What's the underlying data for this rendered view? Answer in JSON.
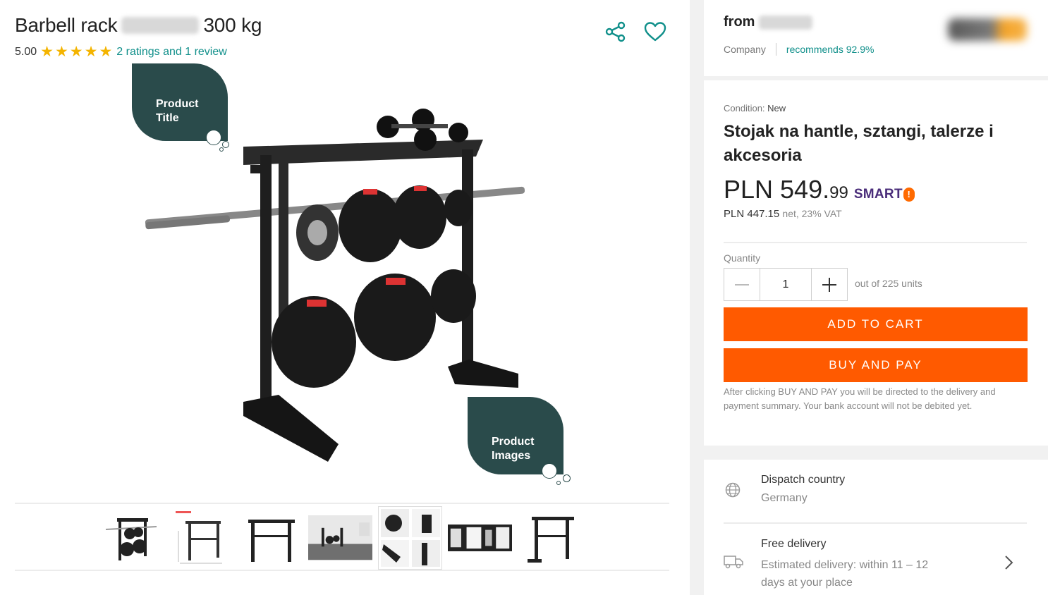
{
  "product": {
    "title_start": "Barbell rack",
    "title_end": "300 kg",
    "rating_score": "5.00",
    "rating_count": 5,
    "ratings_link": "2 ratings and 1 review"
  },
  "annotations": {
    "title_bubble": [
      "Product",
      "Title"
    ],
    "images_bubble": [
      "Product",
      "Images"
    ]
  },
  "icons": {
    "share": "share-icon",
    "favorite": "heart-icon",
    "dispatch": "globe-icon",
    "delivery": "truck-icon",
    "more": "chevron-right-icon"
  },
  "gallery": {
    "thumb_count": 7
  },
  "seller": {
    "from_label": "from",
    "type": "Company",
    "recommends": "recommends 92.9%"
  },
  "offer": {
    "condition_label": "Condition:",
    "condition_value": "New",
    "title": "Stojak na hantle, sztangi, talerze i akcesoria",
    "price_main": "PLN 549.",
    "price_cents": "99",
    "smart_label": "SMART",
    "net_price": "PLN 447.15",
    "net_suffix": "net, 23% VAT",
    "quantity_label": "Quantity",
    "quantity_value": "1",
    "units_text": "out of 225 units",
    "add_to_cart": "ADD TO CART",
    "buy_and_pay": "BUY AND PAY",
    "disclaimer": "After clicking BUY AND PAY you will be directed to the delivery and payment summary. Your bank account will not be debited yet."
  },
  "shipping": {
    "dispatch_label": "Dispatch country",
    "dispatch_value": "Germany",
    "delivery_label": "Free delivery",
    "delivery_value": "Estimated delivery: within 11 – 12 days at your place"
  },
  "colors": {
    "accent": "#ff5a00",
    "teal": "#0f8f8a",
    "bubble": "#2a4b4b",
    "star": "#f4b400",
    "smart": "#4a2d7a"
  }
}
